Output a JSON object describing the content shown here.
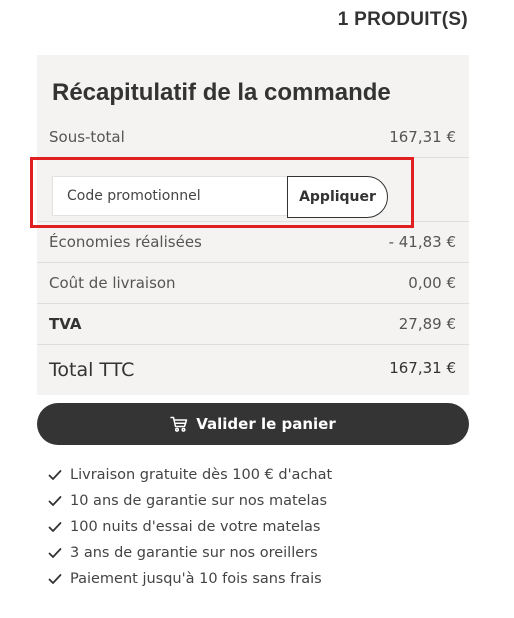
{
  "header": {
    "product_count": "1 PRODUIT(S)"
  },
  "summary": {
    "title": "Récapitulatif de la commande",
    "subtotal": {
      "label": "Sous-total",
      "value": "167,31 €"
    },
    "promo": {
      "placeholder": "Code promotionnel",
      "apply_label": "Appliquer"
    },
    "savings": {
      "label": "Économies réalisées",
      "value": "- 41,83 €"
    },
    "shipping": {
      "label": "Coût de livraison",
      "value": "0,00 €"
    },
    "vat": {
      "label": "TVA",
      "value": "27,89 €"
    },
    "total": {
      "label": "Total TTC",
      "value": "167,31 €"
    }
  },
  "checkout": {
    "label": "Valider le panier",
    "icon": "cart-icon"
  },
  "benefits": [
    "Livraison gratuite dès 100 € d'achat",
    "10 ans de garantie sur nos matelas",
    "100 nuits d'essai de votre matelas",
    "3 ans de garantie sur nos oreillers",
    "Paiement jusqu'à 10 fois sans frais"
  ],
  "colors": {
    "panel_bg": "#f4f3f1",
    "button_dark": "#333433",
    "highlight": "#e02020",
    "text": "#333333"
  }
}
